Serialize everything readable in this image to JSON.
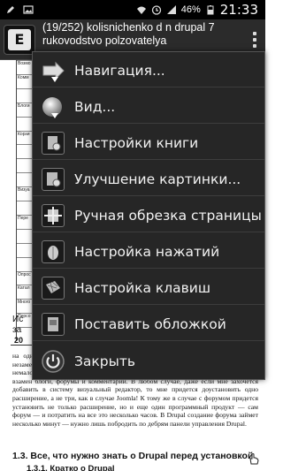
{
  "status_bar": {
    "battery": "46%",
    "time": "21:33",
    "icons": [
      "pen-icon",
      "image-icon",
      "wifi-icon",
      "alarm-icon",
      "signal-icon",
      "battery-icon"
    ]
  },
  "title_bar": {
    "title": "(19/252) kolisnichenko d n drupal 7 rukovodstvo polzovatelya",
    "overflow_icon": "overflow-menu-icon"
  },
  "document": {
    "table_rows": [
      "Возмо",
      "Комм",
      "",
      "Блоги",
      "",
      "Корзи",
      "",
      "",
      "",
      "Визуа",
      "",
      "Пере",
      "",
      "",
      "",
      "Опрос",
      "Катал",
      "Много",
      "Персо",
      ""
    ],
    "side_text": [
      "Ис",
      "за"
    ],
    "page_number": "20",
    "body_text": "на одной установке Drupal — для создания портала и сайта сообщества это незаменимая возможность. Блоги, форумы, комментарии и опросы — тоже немаловажно. Лично я тестировал возможность визуальным редактором, получив взамен блоги, форумы и комментарии. В любом случае, даже если мне захочется добавить в систему визуальный редактор, то мне придется доустановить одно расширение, а не три, как в случае Joomla! К тому же в случае с форумом придется установить не только расширение, но и еще один программный продукт — сам форум — и потратить на все это несколько часов. В Drupal создание форума займет несколько минут — нужно лишь побродить по дебрям панели управления Drupal.",
    "heading_2": "1.3. Все, что нужно знать о Drupal перед установкой",
    "heading_3": "1.3.1. Кратко о Drupal"
  },
  "menu": {
    "items": [
      {
        "label": "Навигация...",
        "icon": "navigation-icon"
      },
      {
        "label": "Вид...",
        "icon": "view-icon"
      },
      {
        "label": "Настройки книги",
        "icon": "book-settings-icon"
      },
      {
        "label": "Улучшение картинки...",
        "icon": "image-enhance-icon"
      },
      {
        "label": "Ручная обрезка страницы",
        "icon": "crop-page-icon"
      },
      {
        "label": "Настройка нажатий",
        "icon": "tap-settings-icon"
      },
      {
        "label": "Настройка клавиш",
        "icon": "key-settings-icon"
      },
      {
        "label": "Поставить обложкой",
        "icon": "set-cover-icon"
      },
      {
        "label": "Закрыть",
        "icon": "power-icon"
      }
    ]
  },
  "colors": {
    "menu_background": "#262626",
    "title_background": "#2b2b2b",
    "status_background": "#000000"
  }
}
